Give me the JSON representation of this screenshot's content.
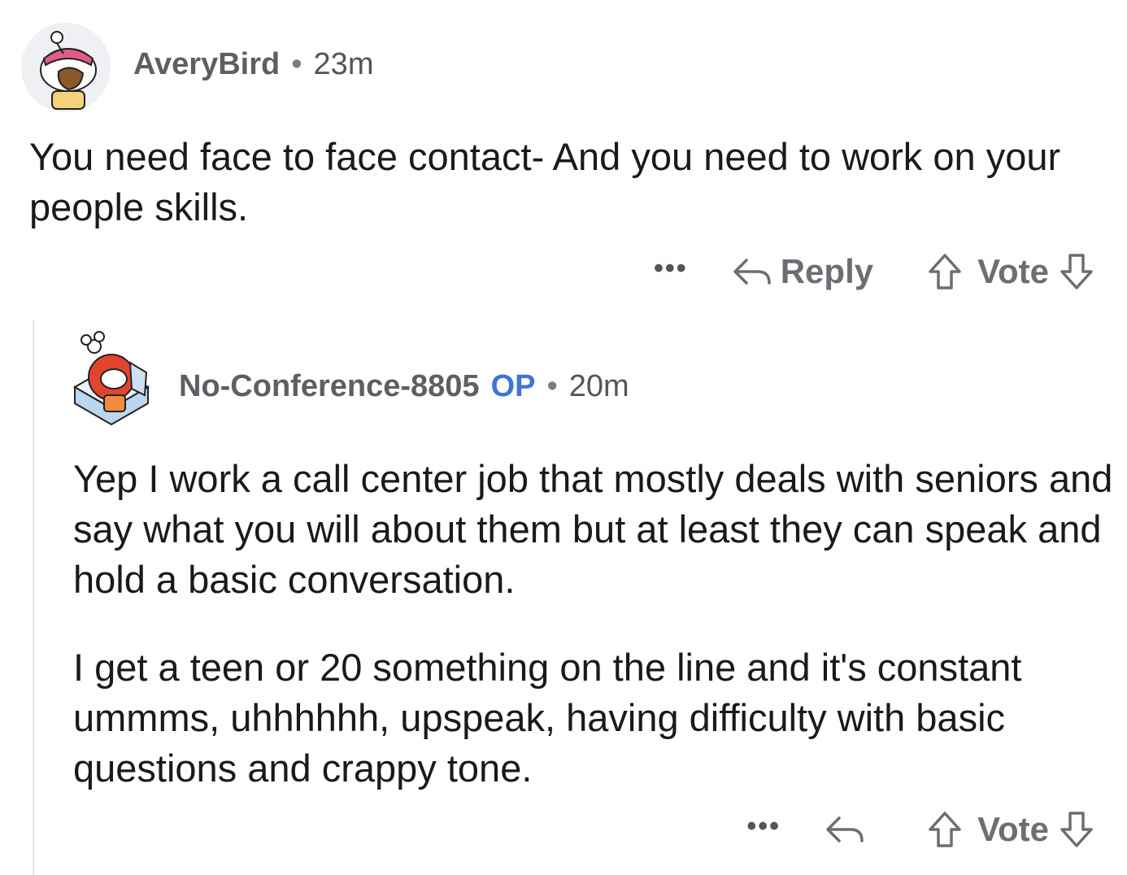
{
  "comments": [
    {
      "author": "AveryBird",
      "separator": "•",
      "time": "23m",
      "body": [
        "You need face to face contact- And you need to work on your people skills."
      ],
      "actions": {
        "more": "•••",
        "reply_label": "Reply",
        "vote_label": "Vote"
      }
    },
    {
      "author": "No-Conference-8805",
      "badge": "OP",
      "separator": "•",
      "time": "20m",
      "body": [
        "Yep I work a call center job that mostly deals with seniors and say what you will about them but at least they can speak and hold a basic conversation.",
        "I get a teen or 20 something  on the line and it's constant ummms, uhhhhhh, upspeak, having difficulty with basic questions and crappy tone."
      ],
      "actions": {
        "more": "•••",
        "vote_label": "Vote"
      }
    }
  ],
  "colors": {
    "op_badge": "#3f73d6",
    "meta_text": "#6b6f73",
    "body_text": "#1a1a1b",
    "thread_line": "#e3e5e8"
  },
  "icons": [
    "avatar-snoo-averybird",
    "avatar-snoo-noconference",
    "reply-arrow-icon",
    "upvote-arrow-icon",
    "downvote-arrow-icon",
    "more-options-icon"
  ]
}
